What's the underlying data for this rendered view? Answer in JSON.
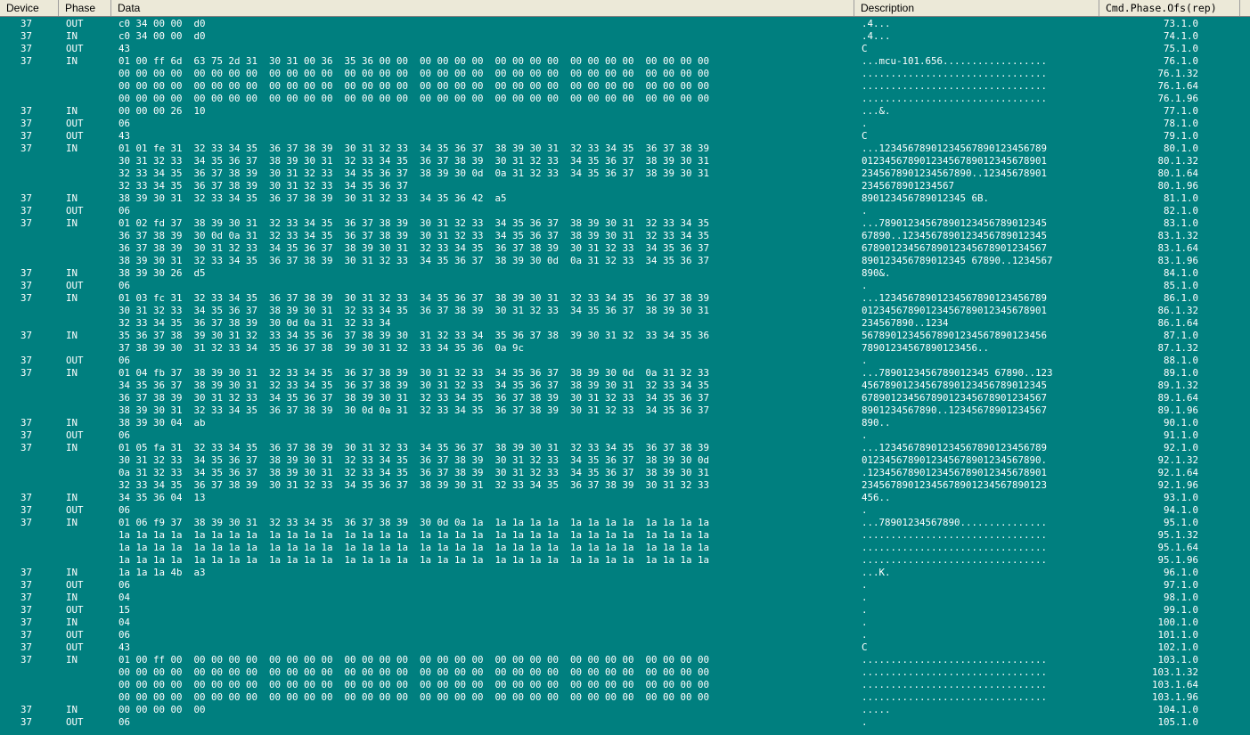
{
  "columns": {
    "device": "Device",
    "phase": "Phase",
    "data": "Data",
    "description": "Description",
    "cmd": "Cmd.Phase.Ofs(rep)"
  },
  "colors": {
    "background": "#007f7f",
    "header": "#ece9d8",
    "text": "#ffffff"
  },
  "rows": [
    {
      "device": "37",
      "phase": "OUT",
      "data": "c0 34 00 00  d0",
      "desc": ".4...",
      "cmd": "73.1.0"
    },
    {
      "device": "37",
      "phase": "IN",
      "data": "c0 34 00 00  d0",
      "desc": ".4...",
      "cmd": "74.1.0"
    },
    {
      "device": "37",
      "phase": "OUT",
      "data": "43",
      "desc": "C",
      "cmd": "75.1.0"
    },
    {
      "device": "37",
      "phase": "IN",
      "data": "01 00 ff 6d  63 75 2d 31  30 31 00 36  35 36 00 00  00 00 00 00  00 00 00 00  00 00 00 00  00 00 00 00",
      "desc": "...mcu-101.656..................",
      "cmd": "76.1.0"
    },
    {
      "device": "",
      "phase": "",
      "data": "00 00 00 00  00 00 00 00  00 00 00 00  00 00 00 00  00 00 00 00  00 00 00 00  00 00 00 00  00 00 00 00",
      "desc": "................................",
      "cmd": "76.1.32"
    },
    {
      "device": "",
      "phase": "",
      "data": "00 00 00 00  00 00 00 00  00 00 00 00  00 00 00 00  00 00 00 00  00 00 00 00  00 00 00 00  00 00 00 00",
      "desc": "................................",
      "cmd": "76.1.64"
    },
    {
      "device": "",
      "phase": "",
      "data": "00 00 00 00  00 00 00 00  00 00 00 00  00 00 00 00  00 00 00 00  00 00 00 00  00 00 00 00  00 00 00 00",
      "desc": "................................",
      "cmd": "76.1.96"
    },
    {
      "device": "37",
      "phase": "IN",
      "data": "00 00 00 26  10",
      "desc": "...&.",
      "cmd": "77.1.0"
    },
    {
      "device": "37",
      "phase": "OUT",
      "data": "06",
      "desc": ".",
      "cmd": "78.1.0"
    },
    {
      "device": "37",
      "phase": "OUT",
      "data": "43",
      "desc": "C",
      "cmd": "79.1.0"
    },
    {
      "device": "37",
      "phase": "IN",
      "data": "01 01 fe 31  32 33 34 35  36 37 38 39  30 31 32 33  34 35 36 37  38 39 30 31  32 33 34 35  36 37 38 39",
      "desc": "...12345678901234567890123456789",
      "cmd": "80.1.0"
    },
    {
      "device": "",
      "phase": "",
      "data": "30 31 32 33  34 35 36 37  38 39 30 31  32 33 34 35  36 37 38 39  30 31 32 33  34 35 36 37  38 39 30 31",
      "desc": "01234567890123456789012345678901",
      "cmd": "80.1.32"
    },
    {
      "device": "",
      "phase": "",
      "data": "32 33 34 35  36 37 38 39  30 31 32 33  34 35 36 37  38 39 30 0d  0a 31 32 33  34 35 36 37  38 39 30 31",
      "desc": "2345678901234567890..12345678901",
      "cmd": "80.1.64"
    },
    {
      "device": "",
      "phase": "",
      "data": "32 33 34 35  36 37 38 39  30 31 32 33  34 35 36 37",
      "desc": "2345678901234567",
      "cmd": "80.1.96"
    },
    {
      "device": "37",
      "phase": "IN",
      "data": "38 39 30 31  32 33 34 35  36 37 38 39  30 31 32 33  34 35 36 42  a5",
      "desc": "890123456789012345 6B.",
      "cmd": "81.1.0"
    },
    {
      "device": "37",
      "phase": "OUT",
      "data": "06",
      "desc": ".",
      "cmd": "82.1.0"
    },
    {
      "device": "37",
      "phase": "IN",
      "data": "01 02 fd 37  38 39 30 31  32 33 34 35  36 37 38 39  30 31 32 33  34 35 36 37  38 39 30 31  32 33 34 35",
      "desc": "...78901234567890123456789012345",
      "cmd": "83.1.0"
    },
    {
      "device": "",
      "phase": "",
      "data": "36 37 38 39  30 0d 0a 31  32 33 34 35  36 37 38 39  30 31 32 33  34 35 36 37  38 39 30 31  32 33 34 35",
      "desc": "67890..1234567890123456789012345",
      "cmd": "83.1.32"
    },
    {
      "device": "",
      "phase": "",
      "data": "36 37 38 39  30 31 32 33  34 35 36 37  38 39 30 31  32 33 34 35  36 37 38 39  30 31 32 33  34 35 36 37",
      "desc": "67890123456789012345678901234567",
      "cmd": "83.1.64"
    },
    {
      "device": "",
      "phase": "",
      "data": "38 39 30 31  32 33 34 35  36 37 38 39  30 31 32 33  34 35 36 37  38 39 30 0d  0a 31 32 33  34 35 36 37",
      "desc": "890123456789012345 67890..1234567",
      "cmd": "83.1.96"
    },
    {
      "device": "37",
      "phase": "IN",
      "data": "38 39 30 26  d5",
      "desc": "890&.",
      "cmd": "84.1.0"
    },
    {
      "device": "37",
      "phase": "OUT",
      "data": "06",
      "desc": ".",
      "cmd": "85.1.0"
    },
    {
      "device": "37",
      "phase": "IN",
      "data": "01 03 fc 31  32 33 34 35  36 37 38 39  30 31 32 33  34 35 36 37  38 39 30 31  32 33 34 35  36 37 38 39",
      "desc": "...12345678901234567890123456789",
      "cmd": "86.1.0"
    },
    {
      "device": "",
      "phase": "",
      "data": "30 31 32 33  34 35 36 37  38 39 30 31  32 33 34 35  36 37 38 39  30 31 32 33  34 35 36 37  38 39 30 31",
      "desc": "01234567890123456789012345678901",
      "cmd": "86.1.32"
    },
    {
      "device": "",
      "phase": "",
      "data": "32 33 34 35  36 37 38 39  30 0d 0a 31  32 33 34",
      "desc": "234567890..1234",
      "cmd": "86.1.64"
    },
    {
      "device": "37",
      "phase": "IN",
      "data": "35 36 37 38  39 30 31 32  33 34 35 36  37 38 39 30  31 32 33 34  35 36 37 38  39 30 31 32  33 34 35 36",
      "desc": "56789012345678901234567890123456",
      "cmd": "87.1.0"
    },
    {
      "device": "",
      "phase": "",
      "data": "37 38 39 30  31 32 33 34  35 36 37 38  39 30 31 32  33 34 35 36  0a 9c",
      "desc": "78901234567890123456..",
      "cmd": "87.1.32"
    },
    {
      "device": "37",
      "phase": "OUT",
      "data": "06",
      "desc": ".",
      "cmd": "88.1.0"
    },
    {
      "device": "37",
      "phase": "IN",
      "data": "01 04 fb 37  38 39 30 31  32 33 34 35  36 37 38 39  30 31 32 33  34 35 36 37  38 39 30 0d  0a 31 32 33",
      "desc": "...7890123456789012345 67890..123",
      "cmd": "89.1.0"
    },
    {
      "device": "",
      "phase": "",
      "data": "34 35 36 37  38 39 30 31  32 33 34 35  36 37 38 39  30 31 32 33  34 35 36 37  38 39 30 31  32 33 34 35",
      "desc": "45678901234567890123456789012345",
      "cmd": "89.1.32"
    },
    {
      "device": "",
      "phase": "",
      "data": "36 37 38 39  30 31 32 33  34 35 36 37  38 39 30 31  32 33 34 35  36 37 38 39  30 31 32 33  34 35 36 37",
      "desc": "67890123456789012345678901234567",
      "cmd": "89.1.64"
    },
    {
      "device": "",
      "phase": "",
      "data": "38 39 30 31  32 33 34 35  36 37 38 39  30 0d 0a 31  32 33 34 35  36 37 38 39  30 31 32 33  34 35 36 37",
      "desc": "8901234567890..12345678901234567",
      "cmd": "89.1.96"
    },
    {
      "device": "37",
      "phase": "IN",
      "data": "38 39 30 04  ab",
      "desc": "890..",
      "cmd": "90.1.0"
    },
    {
      "device": "37",
      "phase": "OUT",
      "data": "06",
      "desc": ".",
      "cmd": "91.1.0"
    },
    {
      "device": "37",
      "phase": "IN",
      "data": "01 05 fa 31  32 33 34 35  36 37 38 39  30 31 32 33  34 35 36 37  38 39 30 31  32 33 34 35  36 37 38 39",
      "desc": "...12345678901234567890123456789",
      "cmd": "92.1.0"
    },
    {
      "device": "",
      "phase": "",
      "data": "30 31 32 33  34 35 36 37  38 39 30 31  32 33 34 35  36 37 38 39  30 31 32 33  34 35 36 37  38 39 30 0d",
      "desc": "0123456789012345678901234567890.",
      "cmd": "92.1.32"
    },
    {
      "device": "",
      "phase": "",
      "data": "0a 31 32 33  34 35 36 37  38 39 30 31  32 33 34 35  36 37 38 39  30 31 32 33  34 35 36 37  38 39 30 31",
      "desc": ".1234567890123456789012345678901",
      "cmd": "92.1.64"
    },
    {
      "device": "",
      "phase": "",
      "data": "32 33 34 35  36 37 38 39  30 31 32 33  34 35 36 37  38 39 30 31  32 33 34 35  36 37 38 39  30 31 32 33",
      "desc": "23456789012345678901234567890123",
      "cmd": "92.1.96"
    },
    {
      "device": "37",
      "phase": "IN",
      "data": "34 35 36 04  13",
      "desc": "456..",
      "cmd": "93.1.0"
    },
    {
      "device": "37",
      "phase": "OUT",
      "data": "06",
      "desc": ".",
      "cmd": "94.1.0"
    },
    {
      "device": "37",
      "phase": "IN",
      "data": "01 06 f9 37  38 39 30 31  32 33 34 35  36 37 38 39  30 0d 0a 1a  1a 1a 1a 1a  1a 1a 1a 1a  1a 1a 1a 1a",
      "desc": "...78901234567890...............",
      "cmd": "95.1.0"
    },
    {
      "device": "",
      "phase": "",
      "data": "1a 1a 1a 1a  1a 1a 1a 1a  1a 1a 1a 1a  1a 1a 1a 1a  1a 1a 1a 1a  1a 1a 1a 1a  1a 1a 1a 1a  1a 1a 1a 1a",
      "desc": "................................",
      "cmd": "95.1.32"
    },
    {
      "device": "",
      "phase": "",
      "data": "1a 1a 1a 1a  1a 1a 1a 1a  1a 1a 1a 1a  1a 1a 1a 1a  1a 1a 1a 1a  1a 1a 1a 1a  1a 1a 1a 1a  1a 1a 1a 1a",
      "desc": "................................",
      "cmd": "95.1.64"
    },
    {
      "device": "",
      "phase": "",
      "data": "1a 1a 1a 1a  1a 1a 1a 1a  1a 1a 1a 1a  1a 1a 1a 1a  1a 1a 1a 1a  1a 1a 1a 1a  1a 1a 1a 1a  1a 1a 1a 1a",
      "desc": "................................",
      "cmd": "95.1.96"
    },
    {
      "device": "37",
      "phase": "IN",
      "data": "1a 1a 1a 4b  a3",
      "desc": "...K.",
      "cmd": "96.1.0"
    },
    {
      "device": "37",
      "phase": "OUT",
      "data": "06",
      "desc": ".",
      "cmd": "97.1.0"
    },
    {
      "device": "37",
      "phase": "IN",
      "data": "04",
      "desc": ".",
      "cmd": "98.1.0"
    },
    {
      "device": "37",
      "phase": "OUT",
      "data": "15",
      "desc": ".",
      "cmd": "99.1.0"
    },
    {
      "device": "37",
      "phase": "IN",
      "data": "04",
      "desc": ".",
      "cmd": "100.1.0"
    },
    {
      "device": "37",
      "phase": "OUT",
      "data": "06",
      "desc": ".",
      "cmd": "101.1.0"
    },
    {
      "device": "37",
      "phase": "OUT",
      "data": "43",
      "desc": "C",
      "cmd": "102.1.0"
    },
    {
      "device": "37",
      "phase": "IN",
      "data": "01 00 ff 00  00 00 00 00  00 00 00 00  00 00 00 00  00 00 00 00  00 00 00 00  00 00 00 00  00 00 00 00",
      "desc": "................................",
      "cmd": "103.1.0"
    },
    {
      "device": "",
      "phase": "",
      "data": "00 00 00 00  00 00 00 00  00 00 00 00  00 00 00 00  00 00 00 00  00 00 00 00  00 00 00 00  00 00 00 00",
      "desc": "................................",
      "cmd": "103.1.32"
    },
    {
      "device": "",
      "phase": "",
      "data": "00 00 00 00  00 00 00 00  00 00 00 00  00 00 00 00  00 00 00 00  00 00 00 00  00 00 00 00  00 00 00 00",
      "desc": "................................",
      "cmd": "103.1.64"
    },
    {
      "device": "",
      "phase": "",
      "data": "00 00 00 00  00 00 00 00  00 00 00 00  00 00 00 00  00 00 00 00  00 00 00 00  00 00 00 00  00 00 00 00",
      "desc": "................................",
      "cmd": "103.1.96"
    },
    {
      "device": "37",
      "phase": "IN",
      "data": "00 00 00 00  00",
      "desc": ".....",
      "cmd": "104.1.0"
    },
    {
      "device": "37",
      "phase": "OUT",
      "data": "06",
      "desc": ".",
      "cmd": "105.1.0"
    }
  ]
}
